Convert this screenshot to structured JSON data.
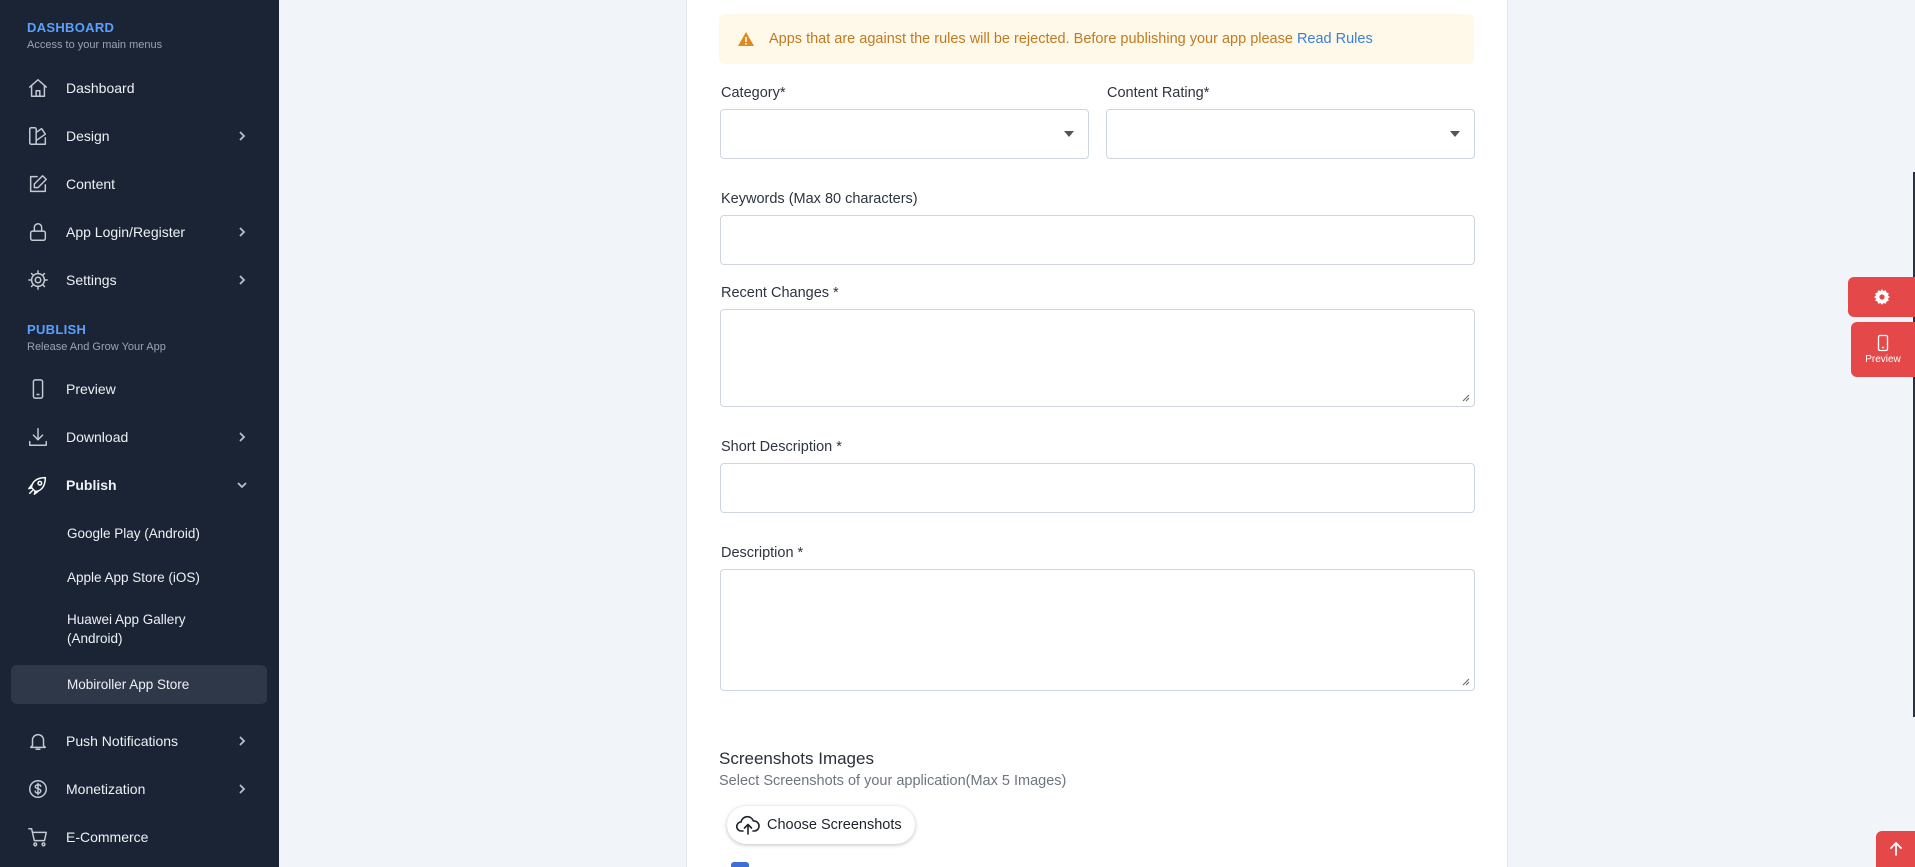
{
  "sidebar": {
    "dashboard_section": {
      "title": "DASHBOARD",
      "subtitle": "Access to your main menus"
    },
    "publish_section": {
      "title": "PUBLISH",
      "subtitle": "Release And Grow Your App"
    },
    "items": {
      "dashboard": "Dashboard",
      "design": "Design",
      "content": "Content",
      "app_login": "App Login/Register",
      "settings": "Settings",
      "preview": "Preview",
      "download": "Download",
      "publish": "Publish",
      "push": "Push Notifications",
      "monetization": "Monetization",
      "ecommerce": "E-Commerce"
    },
    "publish_sub": {
      "google_play": "Google Play (Android)",
      "apple": "Apple App Store (iOS)",
      "huawei_line1": "Huawei App Gallery",
      "huawei_line2": "(Android)",
      "mobiroller": "Mobiroller App Store"
    }
  },
  "alert": {
    "text": "Apps that are against the rules will be rejected. Before publishing your app please",
    "link": "Read Rules"
  },
  "form": {
    "category_label": "Category*",
    "content_rating_label": "Content Rating*",
    "keywords_label": "Keywords (Max 80 characters)",
    "recent_changes_label": "Recent Changes *",
    "short_description_label": "Short Description *",
    "description_label": "Description *"
  },
  "screenshots": {
    "title": "Screenshots Images",
    "subtitle": "Select Screenshots of your application(Max 5 Images)",
    "button": "Choose Screenshots"
  },
  "floating": {
    "preview_label": "Preview"
  },
  "colors": {
    "sidebar_bg": "#1a2434",
    "accent_red": "#e54848",
    "link_blue": "#3d7fd6",
    "warning_text": "#c27a1e"
  }
}
